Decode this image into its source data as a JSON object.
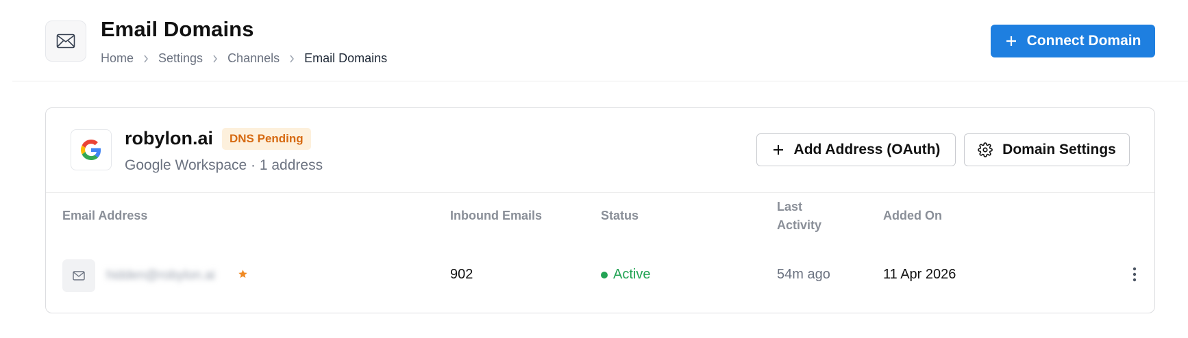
{
  "header": {
    "title": "Email Domains",
    "breadcrumb": [
      "Home",
      "Settings",
      "Channels",
      "Email Domains"
    ],
    "connect_label": "Connect Domain",
    "icon": "mail-icon"
  },
  "domain": {
    "name": "robylon.ai",
    "badge": "DNS Pending",
    "subtitle": "Google Workspace · 1 address",
    "provider_icon": "google-icon",
    "add_address_label": "Add Address (OAuth)",
    "settings_label": "Domain Settings"
  },
  "table": {
    "headers": {
      "email": "Email Address",
      "inbound": "Inbound Emails",
      "status": "Status",
      "last_activity_1": "Last",
      "last_activity_2": "Activity",
      "added_on": "Added On"
    },
    "rows": [
      {
        "email": "hidden@robylon.ai",
        "inbound": "902",
        "status": "Active",
        "last_activity": "54m ago",
        "added_on": "11 Apr 2026"
      }
    ]
  },
  "colors": {
    "primary": "#1e7fe0",
    "badge_bg": "#fdf0dc",
    "badge_text": "#d66a12",
    "active": "#22a354",
    "star": "#f08a24"
  }
}
